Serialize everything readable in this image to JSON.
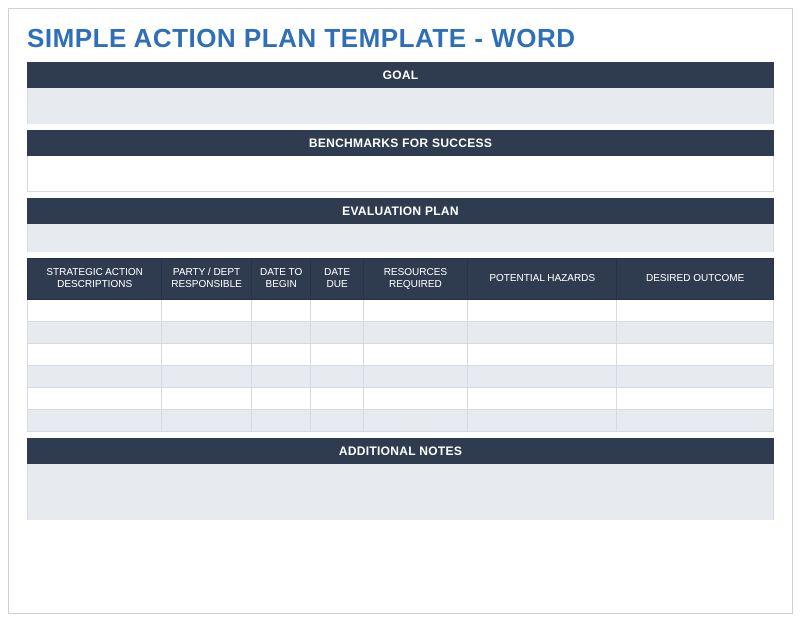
{
  "title": "SIMPLE ACTION PLAN TEMPLATE - WORD",
  "sections": {
    "goal": {
      "header": "GOAL",
      "value": ""
    },
    "benchmarks": {
      "header": "BENCHMARKS FOR SUCCESS",
      "value": ""
    },
    "evaluation": {
      "header": "EVALUATION PLAN",
      "value": ""
    },
    "notes": {
      "header": "ADDITIONAL NOTES",
      "value": ""
    }
  },
  "table": {
    "headers": {
      "desc": "STRATEGIC ACTION DESCRIPTIONS",
      "party": "PARTY / DEPT RESPONSIBLE",
      "begin": "DATE TO BEGIN",
      "due": "DATE DUE",
      "resources": "RESOURCES REQUIRED",
      "hazards": "POTENTIAL HAZARDS",
      "outcome": "DESIRED OUTCOME"
    },
    "rows": [
      {
        "desc": "",
        "party": "",
        "begin": "",
        "due": "",
        "resources": "",
        "hazards": "",
        "outcome": ""
      },
      {
        "desc": "",
        "party": "",
        "begin": "",
        "due": "",
        "resources": "",
        "hazards": "",
        "outcome": ""
      },
      {
        "desc": "",
        "party": "",
        "begin": "",
        "due": "",
        "resources": "",
        "hazards": "",
        "outcome": ""
      },
      {
        "desc": "",
        "party": "",
        "begin": "",
        "due": "",
        "resources": "",
        "hazards": "",
        "outcome": ""
      },
      {
        "desc": "",
        "party": "",
        "begin": "",
        "due": "",
        "resources": "",
        "hazards": "",
        "outcome": ""
      },
      {
        "desc": "",
        "party": "",
        "begin": "",
        "due": "",
        "resources": "",
        "hazards": "",
        "outcome": ""
      }
    ]
  }
}
